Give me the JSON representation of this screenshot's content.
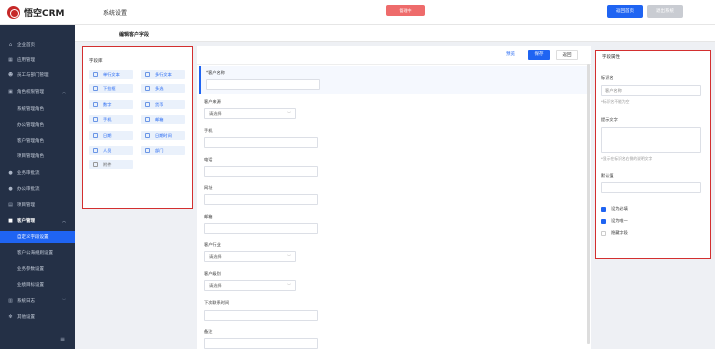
{
  "app": {
    "logo_text": "悟空CRM",
    "module_title": "系统设置"
  },
  "topbar": {
    "red_button": "管理中",
    "primary_button": "返回首页",
    "secondary_button": "退出系统"
  },
  "sidebar": {
    "items": [
      {
        "label": "企业首页",
        "icon": "home-icon",
        "sub": false
      },
      {
        "label": "应用管理",
        "icon": "grid-icon",
        "sub": false
      },
      {
        "label": "员工与部门管理",
        "icon": "users-icon",
        "sub": false
      },
      {
        "label": "角色权限管理",
        "icon": "lock-icon",
        "sub": false,
        "expanded": true
      },
      {
        "label": "系统管理角色",
        "sub": true
      },
      {
        "label": "办公管理角色",
        "sub": true
      },
      {
        "label": "客户管理角色",
        "sub": true
      },
      {
        "label": "项目管理角色",
        "sub": true
      },
      {
        "label": "业务审批流",
        "icon": "user-icon",
        "sub": false
      },
      {
        "label": "办公审批流",
        "icon": "user-icon",
        "sub": false
      },
      {
        "label": "项目管理",
        "icon": "folder-icon",
        "sub": false
      },
      {
        "label": "客户管理",
        "icon": "briefcase-icon",
        "sub": false,
        "expanded": true,
        "bold": true
      },
      {
        "label": "自定义字段设置",
        "sub": true,
        "active": true
      },
      {
        "label": "客户公海规则设置",
        "sub": true
      },
      {
        "label": "业务参数设置",
        "sub": true
      },
      {
        "label": "业绩目标设置",
        "sub": true
      },
      {
        "label": "系统日志",
        "icon": "file-icon",
        "sub": false,
        "chevron": true
      },
      {
        "label": "其他设置",
        "icon": "gear-icon",
        "sub": false
      }
    ]
  },
  "breadcrumb": {
    "title": "编辑客户字段"
  },
  "field_library": {
    "title": "字段库",
    "fields": [
      {
        "label": "单行文本"
      },
      {
        "label": "多行文本"
      },
      {
        "label": "下拉框"
      },
      {
        "label": "多选"
      },
      {
        "label": "数字"
      },
      {
        "label": "货币"
      },
      {
        "label": "手机"
      },
      {
        "label": "邮箱"
      },
      {
        "label": "日期"
      },
      {
        "label": "日期时间"
      },
      {
        "label": "人员"
      },
      {
        "label": "部门"
      },
      {
        "label": "附件"
      }
    ]
  },
  "toolbar": {
    "preview_label": "预览",
    "save_label": "保存",
    "back_label": "返回"
  },
  "form": {
    "fields": [
      {
        "label": "*客户名称",
        "type": "input"
      },
      {
        "label": "客户来源",
        "type": "select",
        "value": "请选择"
      },
      {
        "label": "手机",
        "type": "input"
      },
      {
        "label": "电话",
        "type": "input"
      },
      {
        "label": "网址",
        "type": "input"
      },
      {
        "label": "邮箱",
        "type": "input"
      },
      {
        "label": "客户行业",
        "type": "select",
        "value": "请选择"
      },
      {
        "label": "客户级别",
        "type": "select",
        "value": "请选择"
      },
      {
        "label": "下次联系时间",
        "type": "input"
      },
      {
        "label": "备注",
        "type": "input"
      }
    ]
  },
  "properties": {
    "title": "字段属性",
    "name_label": "标识名",
    "name_value": "客户名称",
    "name_hint": "*标识名不能为空",
    "tip_label": "提示文字",
    "tip_hint": "*显示在标识名右侧的说明文字",
    "default_label": "默认值",
    "checks": [
      {
        "label": "设为必填",
        "checked": true
      },
      {
        "label": "设为唯一",
        "checked": true
      },
      {
        "label": "隐藏字段",
        "checked": false
      }
    ]
  },
  "colors": {
    "accent": "#1f64f2",
    "sidebar": "#243046",
    "highlight": "#d32f2f"
  }
}
